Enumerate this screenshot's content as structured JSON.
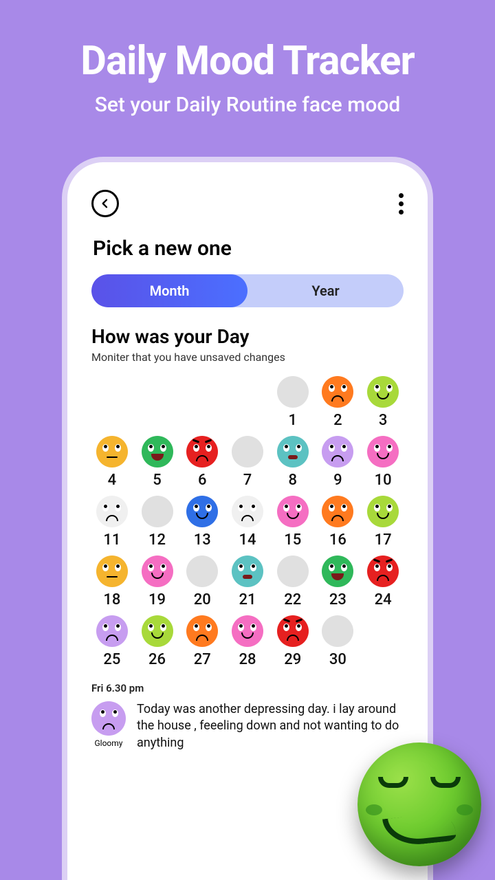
{
  "hero": {
    "title": "Daily Mood Tracker",
    "subtitle": "Set your Daily Routine face mood"
  },
  "screen": {
    "pick_title": "Pick a new one",
    "tabs": {
      "month": "Month",
      "year": "Year"
    },
    "how_title": "How was your Day",
    "how_sub": "Moniter that you have unsaved changes",
    "entry": {
      "time": "Fri 6.30 pm",
      "mood_label": "Gloomy",
      "text": "Today was another depressing day. i lay around the house , feeeling down and not wanting to do anything"
    }
  },
  "days": [
    {
      "n": 1,
      "mood": "none"
    },
    {
      "n": 2,
      "mood": "orange",
      "face": "sad"
    },
    {
      "n": 3,
      "mood": "lime",
      "face": "smile"
    },
    {
      "n": 4,
      "mood": "amber",
      "face": "neutral"
    },
    {
      "n": 5,
      "mood": "green",
      "face": "grin"
    },
    {
      "n": 6,
      "mood": "red",
      "face": "angry"
    },
    {
      "n": 7,
      "mood": "none"
    },
    {
      "n": 8,
      "mood": "teal",
      "face": "worry"
    },
    {
      "n": 9,
      "mood": "lilac",
      "face": "sad"
    },
    {
      "n": 10,
      "mood": "pink",
      "face": "smile"
    },
    {
      "n": 11,
      "mood": "white",
      "face": "sad"
    },
    {
      "n": 12,
      "mood": "none"
    },
    {
      "n": 13,
      "mood": "blue",
      "face": "smile"
    },
    {
      "n": 14,
      "mood": "white",
      "face": "sad"
    },
    {
      "n": 15,
      "mood": "pink",
      "face": "smile"
    },
    {
      "n": 16,
      "mood": "orange",
      "face": "sad"
    },
    {
      "n": 17,
      "mood": "lime",
      "face": "smile"
    },
    {
      "n": 18,
      "mood": "amber",
      "face": "neutral"
    },
    {
      "n": 19,
      "mood": "pink",
      "face": "smile"
    },
    {
      "n": 20,
      "mood": "none"
    },
    {
      "n": 21,
      "mood": "teal",
      "face": "worry"
    },
    {
      "n": 22,
      "mood": "none"
    },
    {
      "n": 23,
      "mood": "green",
      "face": "grin"
    },
    {
      "n": 24,
      "mood": "red",
      "face": "angry"
    },
    {
      "n": 25,
      "mood": "lilac",
      "face": "sad"
    },
    {
      "n": 26,
      "mood": "lime",
      "face": "smile"
    },
    {
      "n": 27,
      "mood": "orange",
      "face": "sad"
    },
    {
      "n": 28,
      "mood": "pink",
      "face": "smile"
    },
    {
      "n": 29,
      "mood": "red",
      "face": "angry"
    },
    {
      "n": 30,
      "mood": "none"
    }
  ]
}
